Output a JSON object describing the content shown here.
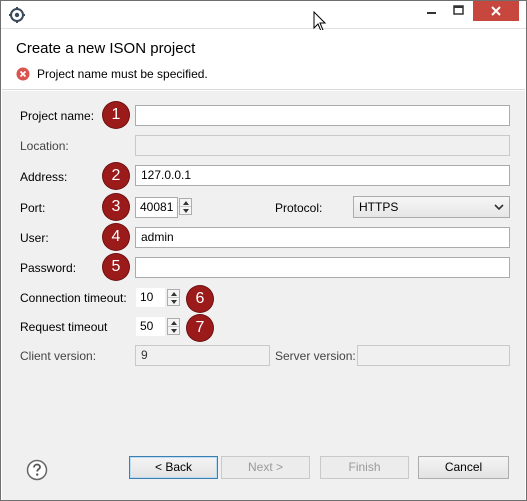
{
  "window": {
    "title": ""
  },
  "header": {
    "title": "Create a new ISON project",
    "message": "Project name must be specified."
  },
  "form": {
    "project_name": {
      "label": "Project name:",
      "value": ""
    },
    "location": {
      "label": "Location:",
      "value": ""
    },
    "address": {
      "label": "Address:",
      "value": "127.0.0.1"
    },
    "port": {
      "label": "Port:",
      "value": "40081"
    },
    "protocol": {
      "label": "Protocol:",
      "value": "HTTPS"
    },
    "user": {
      "label": "User:",
      "value": "admin"
    },
    "password": {
      "label": "Password:",
      "value": ""
    },
    "connection_timeout": {
      "label": "Connection timeout:",
      "value": "10"
    },
    "request_timeout": {
      "label": "Request timeout",
      "value": "50"
    },
    "client_version": {
      "label": "Client version:",
      "value": "9"
    },
    "server_version": {
      "label": "Server version:",
      "value": ""
    }
  },
  "callouts": [
    "1",
    "2",
    "3",
    "4",
    "5",
    "6",
    "7"
  ],
  "footer": {
    "back_label": "< Back",
    "next_label": "Next >",
    "finish_label": "Finish",
    "cancel_label": "Cancel"
  },
  "colors": {
    "callout": "#9b1b1b",
    "close_button": "#c7463d",
    "error_icon": "#d9534f"
  },
  "icons": [
    "app-icon",
    "minimize-icon",
    "maximize-icon",
    "close-icon",
    "mouse-cursor-icon",
    "error-icon",
    "help-icon",
    "chevron-down-icon"
  ]
}
